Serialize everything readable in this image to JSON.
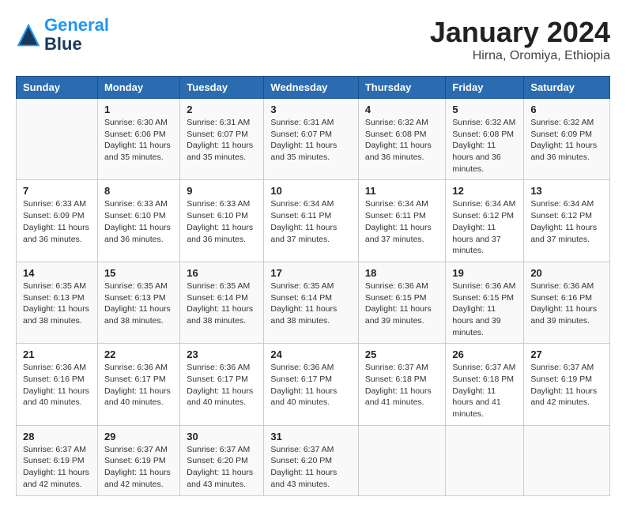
{
  "logo": {
    "line1": "General",
    "line2": "Blue"
  },
  "title": "January 2024",
  "subtitle": "Hirna, Oromiya, Ethiopia",
  "header_color": "#2b6cb0",
  "days_of_week": [
    "Sunday",
    "Monday",
    "Tuesday",
    "Wednesday",
    "Thursday",
    "Friday",
    "Saturday"
  ],
  "weeks": [
    [
      {
        "day": "",
        "sunrise": "",
        "sunset": "",
        "daylight": ""
      },
      {
        "day": "1",
        "sunrise": "Sunrise: 6:30 AM",
        "sunset": "Sunset: 6:06 PM",
        "daylight": "Daylight: 11 hours and 35 minutes."
      },
      {
        "day": "2",
        "sunrise": "Sunrise: 6:31 AM",
        "sunset": "Sunset: 6:07 PM",
        "daylight": "Daylight: 11 hours and 35 minutes."
      },
      {
        "day": "3",
        "sunrise": "Sunrise: 6:31 AM",
        "sunset": "Sunset: 6:07 PM",
        "daylight": "Daylight: 11 hours and 35 minutes."
      },
      {
        "day": "4",
        "sunrise": "Sunrise: 6:32 AM",
        "sunset": "Sunset: 6:08 PM",
        "daylight": "Daylight: 11 hours and 36 minutes."
      },
      {
        "day": "5",
        "sunrise": "Sunrise: 6:32 AM",
        "sunset": "Sunset: 6:08 PM",
        "daylight": "Daylight: 11 hours and 36 minutes."
      },
      {
        "day": "6",
        "sunrise": "Sunrise: 6:32 AM",
        "sunset": "Sunset: 6:09 PM",
        "daylight": "Daylight: 11 hours and 36 minutes."
      }
    ],
    [
      {
        "day": "7",
        "sunrise": "Sunrise: 6:33 AM",
        "sunset": "Sunset: 6:09 PM",
        "daylight": "Daylight: 11 hours and 36 minutes."
      },
      {
        "day": "8",
        "sunrise": "Sunrise: 6:33 AM",
        "sunset": "Sunset: 6:10 PM",
        "daylight": "Daylight: 11 hours and 36 minutes."
      },
      {
        "day": "9",
        "sunrise": "Sunrise: 6:33 AM",
        "sunset": "Sunset: 6:10 PM",
        "daylight": "Daylight: 11 hours and 36 minutes."
      },
      {
        "day": "10",
        "sunrise": "Sunrise: 6:34 AM",
        "sunset": "Sunset: 6:11 PM",
        "daylight": "Daylight: 11 hours and 37 minutes."
      },
      {
        "day": "11",
        "sunrise": "Sunrise: 6:34 AM",
        "sunset": "Sunset: 6:11 PM",
        "daylight": "Daylight: 11 hours and 37 minutes."
      },
      {
        "day": "12",
        "sunrise": "Sunrise: 6:34 AM",
        "sunset": "Sunset: 6:12 PM",
        "daylight": "Daylight: 11 hours and 37 minutes."
      },
      {
        "day": "13",
        "sunrise": "Sunrise: 6:34 AM",
        "sunset": "Sunset: 6:12 PM",
        "daylight": "Daylight: 11 hours and 37 minutes."
      }
    ],
    [
      {
        "day": "14",
        "sunrise": "Sunrise: 6:35 AM",
        "sunset": "Sunset: 6:13 PM",
        "daylight": "Daylight: 11 hours and 38 minutes."
      },
      {
        "day": "15",
        "sunrise": "Sunrise: 6:35 AM",
        "sunset": "Sunset: 6:13 PM",
        "daylight": "Daylight: 11 hours and 38 minutes."
      },
      {
        "day": "16",
        "sunrise": "Sunrise: 6:35 AM",
        "sunset": "Sunset: 6:14 PM",
        "daylight": "Daylight: 11 hours and 38 minutes."
      },
      {
        "day": "17",
        "sunrise": "Sunrise: 6:35 AM",
        "sunset": "Sunset: 6:14 PM",
        "daylight": "Daylight: 11 hours and 38 minutes."
      },
      {
        "day": "18",
        "sunrise": "Sunrise: 6:36 AM",
        "sunset": "Sunset: 6:15 PM",
        "daylight": "Daylight: 11 hours and 39 minutes."
      },
      {
        "day": "19",
        "sunrise": "Sunrise: 6:36 AM",
        "sunset": "Sunset: 6:15 PM",
        "daylight": "Daylight: 11 hours and 39 minutes."
      },
      {
        "day": "20",
        "sunrise": "Sunrise: 6:36 AM",
        "sunset": "Sunset: 6:16 PM",
        "daylight": "Daylight: 11 hours and 39 minutes."
      }
    ],
    [
      {
        "day": "21",
        "sunrise": "Sunrise: 6:36 AM",
        "sunset": "Sunset: 6:16 PM",
        "daylight": "Daylight: 11 hours and 40 minutes."
      },
      {
        "day": "22",
        "sunrise": "Sunrise: 6:36 AM",
        "sunset": "Sunset: 6:17 PM",
        "daylight": "Daylight: 11 hours and 40 minutes."
      },
      {
        "day": "23",
        "sunrise": "Sunrise: 6:36 AM",
        "sunset": "Sunset: 6:17 PM",
        "daylight": "Daylight: 11 hours and 40 minutes."
      },
      {
        "day": "24",
        "sunrise": "Sunrise: 6:36 AM",
        "sunset": "Sunset: 6:17 PM",
        "daylight": "Daylight: 11 hours and 40 minutes."
      },
      {
        "day": "25",
        "sunrise": "Sunrise: 6:37 AM",
        "sunset": "Sunset: 6:18 PM",
        "daylight": "Daylight: 11 hours and 41 minutes."
      },
      {
        "day": "26",
        "sunrise": "Sunrise: 6:37 AM",
        "sunset": "Sunset: 6:18 PM",
        "daylight": "Daylight: 11 hours and 41 minutes."
      },
      {
        "day": "27",
        "sunrise": "Sunrise: 6:37 AM",
        "sunset": "Sunset: 6:19 PM",
        "daylight": "Daylight: 11 hours and 42 minutes."
      }
    ],
    [
      {
        "day": "28",
        "sunrise": "Sunrise: 6:37 AM",
        "sunset": "Sunset: 6:19 PM",
        "daylight": "Daylight: 11 hours and 42 minutes."
      },
      {
        "day": "29",
        "sunrise": "Sunrise: 6:37 AM",
        "sunset": "Sunset: 6:19 PM",
        "daylight": "Daylight: 11 hours and 42 minutes."
      },
      {
        "day": "30",
        "sunrise": "Sunrise: 6:37 AM",
        "sunset": "Sunset: 6:20 PM",
        "daylight": "Daylight: 11 hours and 43 minutes."
      },
      {
        "day": "31",
        "sunrise": "Sunrise: 6:37 AM",
        "sunset": "Sunset: 6:20 PM",
        "daylight": "Daylight: 11 hours and 43 minutes."
      },
      {
        "day": "",
        "sunrise": "",
        "sunset": "",
        "daylight": ""
      },
      {
        "day": "",
        "sunrise": "",
        "sunset": "",
        "daylight": ""
      },
      {
        "day": "",
        "sunrise": "",
        "sunset": "",
        "daylight": ""
      }
    ]
  ]
}
